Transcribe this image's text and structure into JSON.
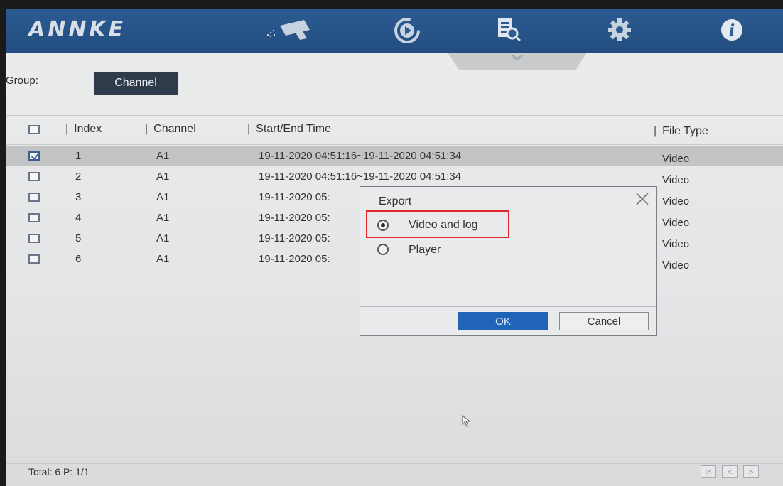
{
  "app": {
    "brand": "ANNKE"
  },
  "nav": [
    {
      "name": "live-view",
      "icon": "camera-icon"
    },
    {
      "name": "playback",
      "icon": "playback-icon"
    },
    {
      "name": "search",
      "icon": "file-search-icon"
    },
    {
      "name": "settings",
      "icon": "gear-icon"
    },
    {
      "name": "info",
      "icon": "info-icon"
    }
  ],
  "collapse": {
    "glyph": "︾",
    "icon": "double-chevron-down-icon"
  },
  "group": {
    "label": "Group:",
    "value": "Channel"
  },
  "table": {
    "headers": {
      "index": "Index",
      "channel": "Channel",
      "time": "Start/End Time",
      "file_type": "File Type"
    },
    "rows": [
      {
        "checked": true,
        "index": "1",
        "channel": "A1",
        "time": "19-11-2020 04:51:16~19-11-2020 04:51:34",
        "type": "Video"
      },
      {
        "checked": false,
        "index": "2",
        "channel": "A1",
        "time": "19-11-2020 04:51:16~19-11-2020 04:51:34",
        "type": "Video"
      },
      {
        "checked": false,
        "index": "3",
        "channel": "A1",
        "time": "19-11-2020 05:",
        "type": "Video"
      },
      {
        "checked": false,
        "index": "4",
        "channel": "A1",
        "time": "19-11-2020 05:",
        "type": "Video"
      },
      {
        "checked": false,
        "index": "5",
        "channel": "A1",
        "time": "19-11-2020 05:",
        "type": "Video"
      },
      {
        "checked": false,
        "index": "6",
        "channel": "A1",
        "time": "19-11-2020 05:",
        "type": "Video"
      }
    ]
  },
  "dialog": {
    "title": "Export",
    "options": [
      {
        "label": "Video and log",
        "selected": true
      },
      {
        "label": "Player",
        "selected": false
      }
    ],
    "ok": "OK",
    "cancel": "Cancel",
    "highlight_color": "#e1262b"
  },
  "footer": {
    "status": "Total: 6 P: 1/1",
    "pager": [
      "|<",
      "<",
      ">"
    ]
  },
  "colors": {
    "header": "#2c5b91",
    "group_button": "#2f3a4b",
    "ok_button": "#1f64b8"
  }
}
